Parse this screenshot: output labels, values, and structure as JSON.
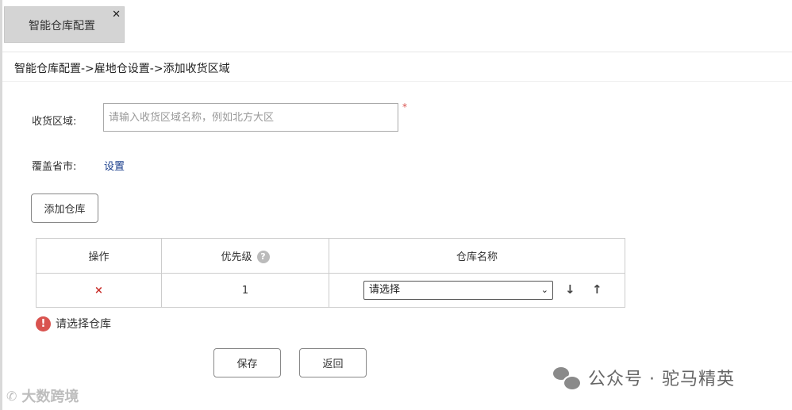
{
  "tab": {
    "title": "智能仓库配置",
    "close": "✕"
  },
  "breadcrumb": "智能仓库配置->雇地仓设置->添加收货区域",
  "form": {
    "area_label": "收货区域:",
    "area_placeholder": "请输入收货区域名称，例如北方大区",
    "required_mark": "*",
    "provinces_label": "覆盖省市:",
    "provinces_link": "设置"
  },
  "add_warehouse_button": "添加仓库",
  "table": {
    "headers": {
      "op": "操作",
      "priority": "优先级",
      "name": "仓库名称"
    },
    "help_icon": "?",
    "rows": [
      {
        "delete": "×",
        "priority": "1",
        "select": "请选择",
        "chevron": "⌄",
        "down": "↓",
        "up": "↑"
      }
    ]
  },
  "error": {
    "icon": "!",
    "text": "请选择仓库"
  },
  "buttons": {
    "save": "保存",
    "back": "返回"
  },
  "watermarks": {
    "left_icon": "✆",
    "left": "大数跨境",
    "right": "公众号 · 驼马精英"
  }
}
